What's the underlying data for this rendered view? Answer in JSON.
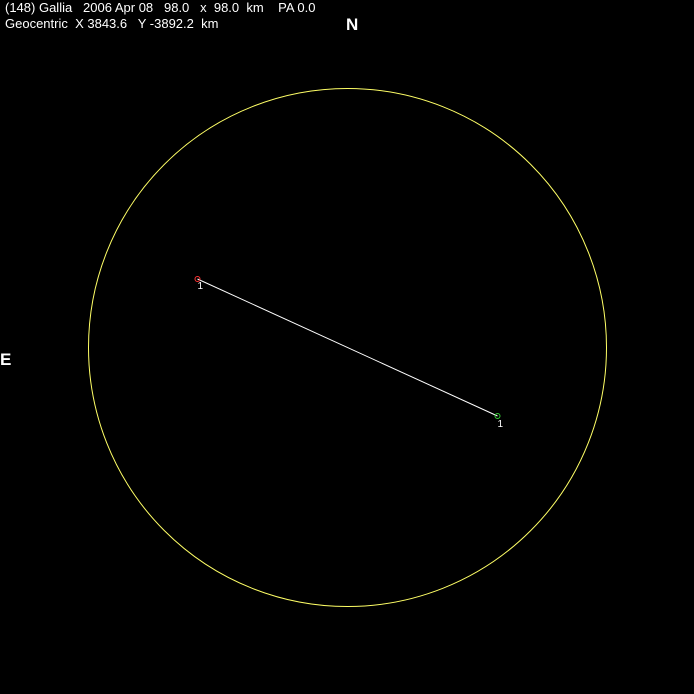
{
  "header": {
    "line1": "(148) Gallia   2006 Apr 08   98.0   x  98.0  km    PA 0.0",
    "line2": "Geocentric  X 3843.6   Y -3892.2  km"
  },
  "directions": {
    "north": "N",
    "east": "E"
  },
  "colors": {
    "background": "#000000",
    "text": "#ffffff",
    "outline": "#ffff66",
    "chord": "#ffffff",
    "start_marker": "#ff3333",
    "end_marker": "#33cc33"
  },
  "chords": [
    {
      "id": "1",
      "start_label": "1",
      "end_label": "1"
    }
  ]
}
